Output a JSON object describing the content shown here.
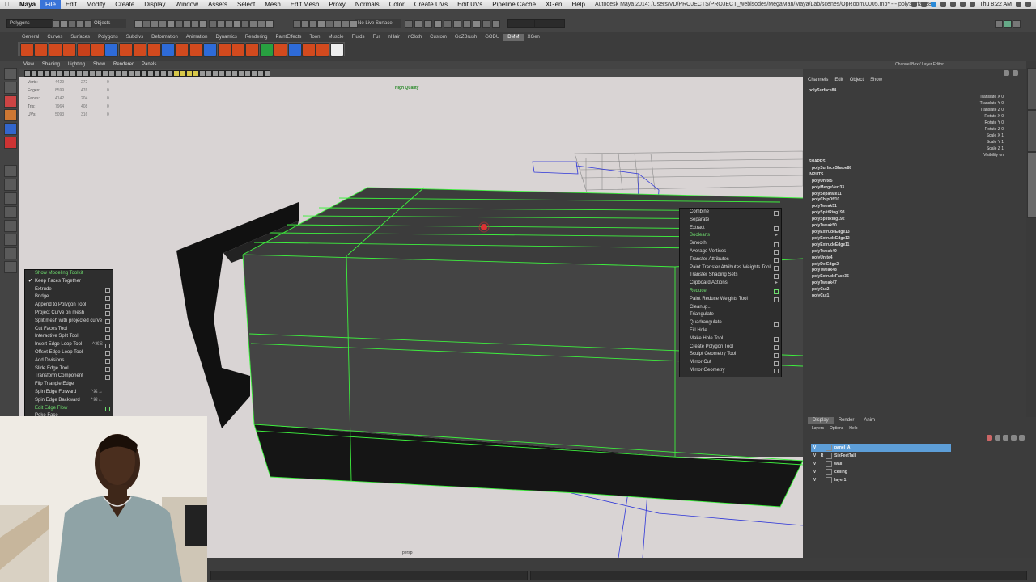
{
  "mac_menu": {
    "app": "Maya",
    "items": [
      "File",
      "Edit",
      "Modify",
      "Create",
      "Display",
      "Window",
      "Assets",
      "Select",
      "Mesh",
      "Edit Mesh",
      "Proxy",
      "Normals",
      "Color",
      "Create UVs",
      "Edit UVs",
      "Pipeline Cache",
      "XGen",
      "Help"
    ],
    "window_title": "Autodesk Maya 2014: /Users/VD/PROJECTS/PROJECT_webisodes/MegaMan/Maya/Lab/scenes/OpRoom.0005.mb*  ---  polySurface84",
    "clock": "Thu 8:22 AM"
  },
  "status_line": {
    "menu_set": "Polygons",
    "selection_mode": "Objects",
    "live_surface": "No Live Surface"
  },
  "shelf": {
    "tabs": [
      "General",
      "Curves",
      "Surfaces",
      "Polygons",
      "Subdivs",
      "Deformation",
      "Animation",
      "Dynamics",
      "Rendering",
      "PaintEffects",
      "Toon",
      "Muscle",
      "Fluids",
      "Fur",
      "nHair",
      "nCloth",
      "Custom",
      "GoZBrush",
      "GODU",
      "DMM",
      "XGen"
    ],
    "active_tab": "DMM",
    "icon_colors": [
      "#d24a1e",
      "#d24a1e",
      "#d24a1e",
      "#d24a1e",
      "#c8401a",
      "#d24a1e",
      "#2e6bd8",
      "#d24a1e",
      "#d24a1e",
      "#d24a1e",
      "#2e6bd8",
      "#d24a1e",
      "#d24a1e",
      "#2e6bd8",
      "#d24a1e",
      "#d24a1e",
      "#d24a1e",
      "#28a040",
      "#d24a1e",
      "#2e6bd8",
      "#d24a1e",
      "#d24a1e",
      "#eeeeee"
    ]
  },
  "viewport": {
    "menu": [
      "View",
      "Shading",
      "Lighting",
      "Show",
      "Renderer",
      "Panels"
    ],
    "hud": [
      {
        "label": "Verts:",
        "a": "4429",
        "b": "272",
        "c": "0"
      },
      {
        "label": "Edges:",
        "a": "8599",
        "b": "476",
        "c": "0"
      },
      {
        "label": "Faces:",
        "a": "4142",
        "b": "204",
        "c": "0"
      },
      {
        "label": "Tris:",
        "a": "7964",
        "b": "408",
        "c": "0"
      },
      {
        "label": "UVs:",
        "a": "5093",
        "b": "316",
        "c": "0"
      }
    ],
    "quality_label": "High Quality",
    "camera_label": "persp"
  },
  "left_marking_menu": {
    "items": [
      {
        "label": "Show Modeling Toolkit",
        "green": true,
        "box": false
      },
      {
        "label": "Keep Faces Together",
        "check": true,
        "box": false
      },
      {
        "label": "Extrude",
        "box": true
      },
      {
        "label": "Bridge",
        "box": true
      },
      {
        "label": "Append to Polygon Tool",
        "box": true
      },
      {
        "label": "Project Curve on mesh",
        "box": true
      },
      {
        "label": "Split mesh with projected curve",
        "box": true
      },
      {
        "label": "Cut Faces Tool",
        "box": true
      },
      {
        "label": "Interactive Split Tool",
        "box": true
      },
      {
        "label": "Insert Edge Loop Tool",
        "shortcut": "^⌘S",
        "box": true
      },
      {
        "label": "Offset Edge Loop Tool",
        "box": true
      },
      {
        "label": "Add Divisions",
        "box": true
      },
      {
        "label": "Slide Edge Tool",
        "box": true
      },
      {
        "label": "Transform Component",
        "box": true
      },
      {
        "label": "Flip Triangle Edge",
        "box": false
      },
      {
        "label": "Spin Edge Forward",
        "shortcut": "^⌘→",
        "box": false
      },
      {
        "label": "Spin Edge Backward",
        "shortcut": "^⌘←",
        "box": false
      },
      {
        "label": "Edit Edge Flow",
        "green": true,
        "box": true
      },
      {
        "label": "Poke Face",
        "box": false
      }
    ]
  },
  "right_marking_menu": {
    "items": [
      {
        "label": "Combine",
        "box": true
      },
      {
        "label": "Separate",
        "box": false
      },
      {
        "label": "Extract",
        "box": true
      },
      {
        "label": "Booleans",
        "green": true,
        "arrow": true
      },
      {
        "label": "Smooth",
        "box": true
      },
      {
        "label": "Average Vertices",
        "box": true
      },
      {
        "label": "Transfer Attributes",
        "box": true
      },
      {
        "label": "Paint Transfer Attributes Weights Tool",
        "box": true
      },
      {
        "label": "Transfer Shading Sets",
        "box": true
      },
      {
        "label": "Clipboard Actions",
        "arrow": true
      },
      {
        "label": "Reduce",
        "green": true,
        "box": true
      },
      {
        "label": "Paint Reduce Weights Tool",
        "box": true
      },
      {
        "label": "Cleanup...",
        "box": false
      },
      {
        "label": "Triangulate",
        "box": false
      },
      {
        "label": "Quadrangulate",
        "box": true
      },
      {
        "label": "Fill Hole",
        "box": false
      },
      {
        "label": "Make Hole Tool",
        "box": true
      },
      {
        "label": "Create Polygon Tool",
        "box": true
      },
      {
        "label": "Sculpt Geometry Tool",
        "box": true
      },
      {
        "label": "Mirror Cut",
        "box": true
      },
      {
        "label": "Mirror Geometry",
        "box": true
      }
    ]
  },
  "channel_box": {
    "header": "Channel Box / Layer Editor",
    "menu": [
      "Channels",
      "Edit",
      "Object",
      "Show"
    ],
    "object": "polySurface84",
    "attributes": [
      {
        "name": "Translate X",
        "value": "0"
      },
      {
        "name": "Translate Y",
        "value": "0"
      },
      {
        "name": "Translate Z",
        "value": "0"
      },
      {
        "name": "Rotate X",
        "value": "0"
      },
      {
        "name": "Rotate Y",
        "value": "0"
      },
      {
        "name": "Rotate Z",
        "value": "0"
      },
      {
        "name": "Scale X",
        "value": "1"
      },
      {
        "name": "Scale Y",
        "value": "1"
      },
      {
        "name": "Scale Z",
        "value": "1"
      },
      {
        "name": "Visibility",
        "value": "on"
      }
    ],
    "shapes_label": "SHAPES",
    "shape": "polySurfaceShape88",
    "inputs_label": "INPUTS",
    "inputs": [
      "polyUnite5",
      "polyMergeVert33",
      "polySeparate11",
      "polyChipOff10",
      "polyTweak51",
      "polySplitRing193",
      "polySplitRing192",
      "polyTweak50",
      "polyExtrudeEdge13",
      "polyExtrudeEdge12",
      "polyExtrudeEdge11",
      "polyTweak49",
      "polyUnite4",
      "polyDelEdge2",
      "polyTweak48",
      "polyExtrudeFace35",
      "polyTweak47",
      "polyCut2",
      "polyCut1"
    ]
  },
  "layer_editor": {
    "tabs": [
      "Display",
      "Render",
      "Anim"
    ],
    "active_tab": "Display",
    "menu": [
      "Layers",
      "Options",
      "Help"
    ],
    "layers": [
      {
        "v": "V",
        "t": "",
        "name": "panel_A",
        "selected": true
      },
      {
        "v": "V",
        "t": "R",
        "name": "SixFeetTall"
      },
      {
        "v": "V",
        "t": "",
        "name": "wall"
      },
      {
        "v": "V",
        "t": "T",
        "name": "ceiling"
      },
      {
        "v": "V",
        "t": "",
        "name": "layer1"
      }
    ]
  },
  "colors": {
    "wire_green": "#3ef03e",
    "selection_blue": "#5d9ed8",
    "viewport_bg": "#d9d4d4"
  }
}
